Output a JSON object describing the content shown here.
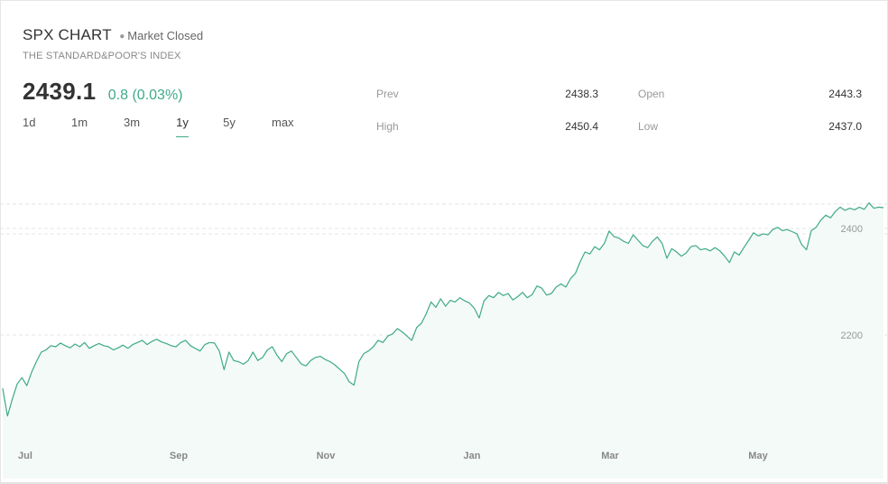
{
  "header": {
    "title": "SPX CHART",
    "market_status": "Market Closed",
    "subtitle": "THE STANDARD&POOR'S INDEX",
    "price": "2439.1",
    "change": "0.8 (0.03%)"
  },
  "range_tabs": [
    {
      "label": "1d",
      "active": false
    },
    {
      "label": "1m",
      "active": false
    },
    {
      "label": "3m",
      "active": false
    },
    {
      "label": "1y",
      "active": true
    },
    {
      "label": "5y",
      "active": false
    },
    {
      "label": "max",
      "active": false
    }
  ],
  "stats": {
    "prev_label": "Prev",
    "prev_value": "2438.3",
    "open_label": "Open",
    "open_value": "2443.3",
    "high_label": "High",
    "high_value": "2450.4",
    "low_label": "Low",
    "low_value": "2437.0"
  },
  "colors": {
    "line": "#3fa98a",
    "fill": "#f3faf7",
    "grid": "#e4e4e4",
    "accent": "#3fa98a"
  },
  "chart_data": {
    "type": "area",
    "x_tick_labels": [
      "Jul",
      "Sep",
      "Nov",
      "Jan",
      "Mar",
      "May"
    ],
    "y_tick_labels": [
      "2200",
      "2400"
    ],
    "y_ticks": [
      2200,
      2400
    ],
    "ylim": [
      2000,
      2430
    ],
    "reference_line": 2439.1,
    "grid": "horizontal-dashed",
    "series": [
      {
        "values": [
          2100,
          2048,
          2080,
          2108,
          2120,
          2105,
          2130,
          2150,
          2168,
          2172,
          2180,
          2178,
          2185,
          2180,
          2176,
          2183,
          2178,
          2186,
          2175,
          2180,
          2184,
          2180,
          2178,
          2172,
          2176,
          2181,
          2175,
          2182,
          2186,
          2190,
          2182,
          2188,
          2192,
          2187,
          2184,
          2180,
          2178,
          2186,
          2190,
          2180,
          2175,
          2170,
          2182,
          2186,
          2185,
          2170,
          2135,
          2168,
          2152,
          2150,
          2145,
          2152,
          2168,
          2152,
          2158,
          2172,
          2178,
          2162,
          2150,
          2165,
          2170,
          2158,
          2146,
          2142,
          2152,
          2158,
          2160,
          2154,
          2150,
          2144,
          2136,
          2128,
          2112,
          2106,
          2150,
          2165,
          2170,
          2178,
          2190,
          2186,
          2198,
          2202,
          2212,
          2206,
          2198,
          2190,
          2214,
          2222,
          2240,
          2262,
          2252,
          2268,
          2254,
          2265,
          2262,
          2270,
          2264,
          2260,
          2250,
          2232,
          2264,
          2274,
          2270,
          2280,
          2274,
          2278,
          2266,
          2272,
          2280,
          2270,
          2276,
          2292,
          2288,
          2275,
          2278,
          2290,
          2296,
          2290,
          2306,
          2316,
          2338,
          2356,
          2352,
          2366,
          2360,
          2372,
          2395,
          2385,
          2382,
          2376,
          2372,
          2388,
          2378,
          2368,
          2364,
          2376,
          2384,
          2372,
          2344,
          2362,
          2356,
          2348,
          2354,
          2366,
          2368,
          2360,
          2362,
          2358,
          2364,
          2358,
          2348,
          2336,
          2356,
          2350,
          2364,
          2378,
          2392,
          2386,
          2390,
          2388,
          2398,
          2402,
          2396,
          2398,
          2394,
          2390,
          2370,
          2360,
          2396,
          2402,
          2416,
          2425,
          2420,
          2432,
          2440,
          2434,
          2438,
          2435,
          2440,
          2436,
          2448,
          2438,
          2440,
          2439
        ]
      }
    ]
  }
}
